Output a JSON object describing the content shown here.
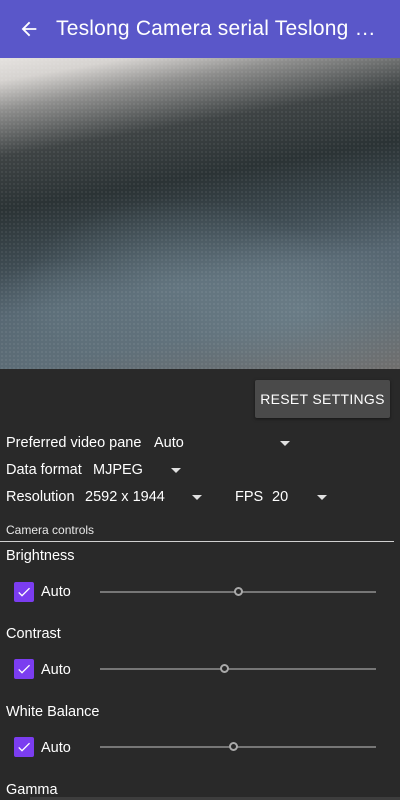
{
  "app_bar": {
    "title": "Teslong Camera serial Teslong camera",
    "back_icon": "arrow-back-icon",
    "color": "#5a57c9"
  },
  "preview": {
    "description_icon": "camera-preview"
  },
  "reset_button": {
    "label": "RESET SETTINGS"
  },
  "settings": {
    "preferred_video_pane": {
      "label": "Preferred video pane",
      "value": "Auto"
    },
    "data_format": {
      "label": "Data format",
      "value": "MJPEG"
    },
    "resolution": {
      "label": "Resolution",
      "value": "2592 x 1944"
    },
    "fps": {
      "label": "FPS",
      "value": "20"
    }
  },
  "camera_controls": {
    "section_label": "Camera controls",
    "accent": "#7b3df0",
    "controls": [
      {
        "title": "Brightness",
        "auto_label": "Auto",
        "auto_checked": true,
        "level": 0.5
      },
      {
        "title": "Contrast",
        "auto_label": "Auto",
        "auto_checked": true,
        "level": 0.45
      },
      {
        "title": "White Balance",
        "auto_label": "Auto",
        "auto_checked": true,
        "level": 0.48
      },
      {
        "title": "Gamma"
      }
    ]
  }
}
